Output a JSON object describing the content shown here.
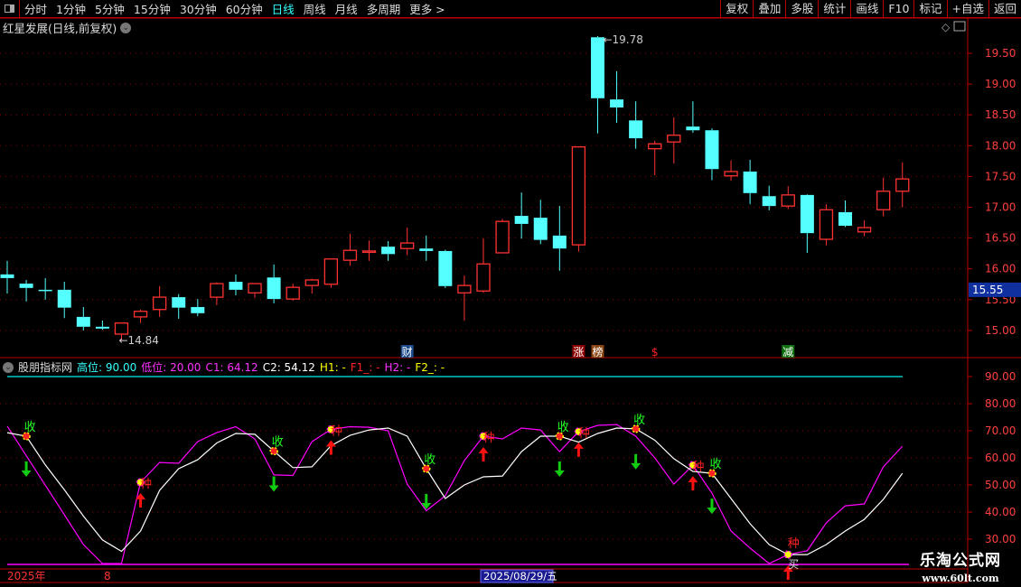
{
  "toolbar": {
    "periods": [
      "分时",
      "1分钟",
      "5分钟",
      "15分钟",
      "30分钟",
      "60分钟",
      "日线",
      "周线",
      "月线",
      "多周期",
      "更多 >"
    ],
    "active_period": "日线",
    "buttons": [
      "复权",
      "叠加",
      "多股",
      "统计",
      "画线",
      "F10",
      "标记",
      "+自选",
      "返回"
    ]
  },
  "title": {
    "stock": "红星发展(日线,前复权)"
  },
  "price_axis": {
    "ticks": [
      "19.50",
      "19.00",
      "18.50",
      "18.00",
      "17.50",
      "17.00",
      "16.50",
      "16.00",
      "15.50",
      "15.00"
    ],
    "current": "15.55"
  },
  "annotations": {
    "high": "19.78",
    "low": "14.84"
  },
  "event_markers": [
    {
      "i": 21,
      "text": "财",
      "bg": "#1a4a8a"
    },
    {
      "i": 30,
      "text": "涨",
      "bg": "#8b0000"
    },
    {
      "i": 31,
      "text": "榜",
      "bg": "#8b4513"
    },
    {
      "i": 34,
      "text": "$",
      "bg": ""
    },
    {
      "i": 41,
      "text": "减",
      "bg": "#107010"
    }
  ],
  "candles": [
    [
      15.91,
      16.13,
      15.6,
      15.85
    ],
    [
      15.76,
      15.82,
      15.47,
      15.69
    ],
    [
      15.66,
      15.85,
      15.5,
      15.66
    ],
    [
      15.66,
      15.79,
      15.2,
      15.37
    ],
    [
      15.22,
      15.38,
      15.0,
      15.06
    ],
    [
      15.06,
      15.16,
      15.01,
      15.03
    ],
    [
      14.94,
      15.12,
      14.84,
      15.12
    ],
    [
      15.22,
      15.34,
      15.12,
      15.31
    ],
    [
      15.34,
      15.72,
      15.22,
      15.54
    ],
    [
      15.54,
      15.59,
      15.19,
      15.37
    ],
    [
      15.38,
      15.51,
      15.23,
      15.28
    ],
    [
      15.54,
      15.78,
      15.41,
      15.76
    ],
    [
      15.79,
      15.91,
      15.57,
      15.66
    ],
    [
      15.61,
      15.76,
      15.53,
      15.76
    ],
    [
      15.86,
      16.07,
      15.44,
      15.51
    ],
    [
      15.51,
      15.76,
      15.48,
      15.7
    ],
    [
      15.73,
      15.84,
      15.6,
      15.82
    ],
    [
      15.75,
      16.16,
      15.69,
      16.16
    ],
    [
      16.14,
      16.57,
      16.05,
      16.3
    ],
    [
      16.29,
      16.46,
      16.13,
      16.29
    ],
    [
      16.36,
      16.45,
      16.13,
      16.24
    ],
    [
      16.33,
      16.67,
      16.22,
      16.42
    ],
    [
      16.33,
      16.54,
      16.13,
      16.29
    ],
    [
      16.29,
      16.31,
      15.69,
      15.72
    ],
    [
      15.61,
      15.89,
      15.16,
      15.73
    ],
    [
      15.64,
      16.49,
      15.61,
      16.08
    ],
    [
      16.26,
      16.81,
      16.26,
      16.77
    ],
    [
      16.86,
      17.24,
      16.49,
      16.73
    ],
    [
      16.83,
      17.12,
      16.4,
      16.47
    ],
    [
      16.54,
      17.02,
      15.97,
      16.33
    ],
    [
      16.39,
      17.98,
      16.28,
      17.98
    ],
    [
      19.76,
      19.78,
      18.2,
      18.77
    ],
    [
      18.75,
      19.21,
      18.37,
      18.62
    ],
    [
      18.41,
      18.72,
      17.95,
      18.12
    ],
    [
      17.95,
      18.08,
      17.52,
      18.03
    ],
    [
      18.06,
      18.46,
      17.71,
      18.17
    ],
    [
      18.31,
      18.72,
      18.21,
      18.25
    ],
    [
      18.25,
      18.28,
      17.44,
      17.62
    ],
    [
      17.51,
      17.76,
      17.43,
      17.58
    ],
    [
      17.58,
      17.77,
      17.05,
      17.23
    ],
    [
      17.18,
      17.35,
      16.95,
      17.02
    ],
    [
      17.02,
      17.34,
      16.97,
      17.2
    ],
    [
      17.2,
      17.21,
      16.26,
      16.58
    ],
    [
      16.48,
      17.05,
      16.38,
      16.96
    ],
    [
      16.92,
      17.11,
      16.68,
      16.7
    ],
    [
      16.6,
      16.79,
      16.53,
      16.67
    ],
    [
      16.96,
      17.48,
      16.85,
      17.26
    ],
    [
      17.26,
      17.73,
      17.0,
      17.46
    ]
  ],
  "colors": {
    "up": "#ff3232",
    "down": "#54ffff",
    "c1": "#ff00ff",
    "c2": "#ffffff",
    "grid": "#8b0000",
    "high_line": "#00c8c8"
  },
  "indicator": {
    "name": "股朋指标网",
    "params": [
      {
        "label": "高位: 90.00",
        "color": "#3ff"
      },
      {
        "label": "低位: 20.00",
        "color": "#f3f"
      },
      {
        "label": "C1: 64.12",
        "color": "#f3f"
      },
      {
        "label": "C2: 54.12",
        "color": "#fff"
      },
      {
        "label": "H1: -",
        "color": "#ff0"
      },
      {
        "label": "F1_: -",
        "color": "#f22"
      },
      {
        "label": "H2: -",
        "color": "#f3f"
      },
      {
        "label": "F2_: -",
        "color": "#ff0"
      }
    ],
    "axis_ticks": [
      "90.00",
      "80.00",
      "70.00",
      "60.00",
      "50.00",
      "40.00",
      "30.00"
    ],
    "high_level": 90,
    "low_level": 20,
    "c1": [
      71.7,
      60.8,
      49.9,
      39,
      28,
      21,
      21,
      51,
      58.3,
      58,
      66,
      69.3,
      71.5,
      67,
      53.7,
      53.5,
      66,
      70.5,
      71.5,
      71.3,
      70,
      50.3,
      40.5,
      46,
      59,
      68,
      67,
      71,
      70.3,
      62.3,
      69.7,
      72,
      72.3,
      68,
      60,
      50.3,
      57.3,
      47,
      33,
      26.7,
      21,
      24.3,
      25.7,
      36,
      42.3,
      43,
      56.7,
      64.3
    ],
    "c2": [
      69.3,
      68,
      57.4,
      48.2,
      38.5,
      29.7,
      25.5,
      33,
      48,
      56,
      59.3,
      65.5,
      69,
      68.7,
      62.5,
      56.4,
      56.7,
      64.5,
      68.3,
      70.3,
      71,
      68,
      56,
      45,
      50,
      53,
      53.3,
      62.3,
      68,
      68,
      65.8,
      69,
      71,
      70.7,
      66.5,
      59.7,
      55,
      54.3,
      45,
      35.7,
      28,
      24.3,
      24.3,
      28,
      33,
      37.3,
      44.7,
      54.3
    ],
    "signals": [
      {
        "i": 1,
        "type": "sell",
        "text": "收"
      },
      {
        "i": 14,
        "type": "sell",
        "text": "收"
      },
      {
        "i": 22,
        "type": "sell",
        "text": "收"
      },
      {
        "i": 29,
        "type": "sell",
        "text": "收"
      },
      {
        "i": 33,
        "type": "sell",
        "text": "收"
      },
      {
        "i": 37,
        "type": "sell",
        "text": "收"
      },
      {
        "i": 7,
        "type": "buy",
        "text": "种"
      },
      {
        "i": 17,
        "type": "buy",
        "text": "种"
      },
      {
        "i": 25,
        "type": "buy",
        "text": "种"
      },
      {
        "i": 30,
        "type": "buy",
        "text": "种"
      },
      {
        "i": 36,
        "type": "buy",
        "text": "种"
      },
      {
        "i": 41,
        "type": "buy",
        "text": "种",
        "extra": "买"
      }
    ]
  },
  "time_axis": {
    "year": "2025年",
    "month": "8",
    "cursor": "2025/08/29/五"
  },
  "watermark": {
    "name": "乐淘公式网",
    "url": "www.60lt.com"
  }
}
